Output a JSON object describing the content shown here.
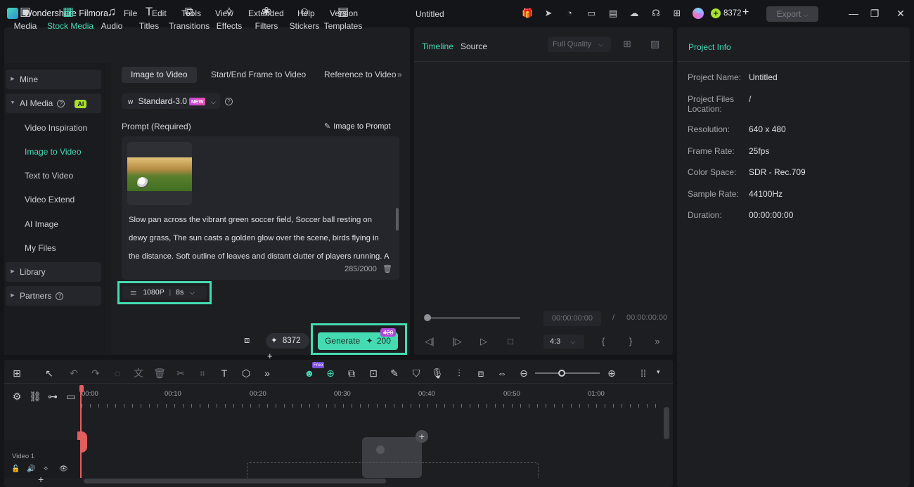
{
  "app": {
    "name": "Wondershare Filmora",
    "doc_title": "Untitled"
  },
  "menu": [
    "File",
    "Edit",
    "Tools",
    "View",
    "Extended",
    "Help",
    "Version"
  ],
  "credits": {
    "value": "8372"
  },
  "export_label": "Export",
  "toolbar": [
    "Media",
    "Stock Media",
    "Audio",
    "Titles",
    "Transitions",
    "Effects",
    "Filters",
    "Stickers",
    "Templates"
  ],
  "sidebar": {
    "mine": "Mine",
    "ai_media": "AI Media",
    "ai_badge": "AI",
    "subitems": [
      "Video Inspiration",
      "Image to Video",
      "Text to Video",
      "Video Extend",
      "AI Image",
      "My Files"
    ],
    "library": "Library",
    "partners": "Partners"
  },
  "content_tabs": [
    "Image to Video",
    "Start/End Frame to Video",
    "Reference to Video"
  ],
  "model": {
    "name": "Standard-3.0",
    "badge": "NEW"
  },
  "prompt": {
    "label": "Prompt (Required)",
    "image_to_prompt": "Image to Prompt",
    "text": "Slow pan across the vibrant green soccer field, Soccer ball resting on dewy grass, The sun casts a golden glow over the scene, birds flying in the distance. Soft outline of leaves and distant clutter of players running. A",
    "counter": "285/2000"
  },
  "settings_chip": {
    "resolution": "1080P",
    "duration": "8s"
  },
  "generate": {
    "label": "Generate",
    "cost": "200",
    "old_cost": "420",
    "credits": "8372"
  },
  "viewer": {
    "tab_timeline": "Timeline",
    "tab_source": "Source",
    "quality": "Full Quality",
    "time_current": "00:00:00:00",
    "time_sep": "/",
    "time_total": "00:00:00:00",
    "ratio": "4:3"
  },
  "project_info": {
    "title": "Project Info",
    "rows": [
      {
        "k": "Project Name:",
        "v": "Untitled"
      },
      {
        "k": "Project Files Location:",
        "v": "/"
      },
      {
        "k": "Resolution:",
        "v": "640 x 480"
      },
      {
        "k": "Frame Rate:",
        "v": "25fps"
      },
      {
        "k": "Color Space:",
        "v": "SDR - Rec.709"
      },
      {
        "k": "Sample Rate:",
        "v": "44100Hz"
      },
      {
        "k": "Duration:",
        "v": "00:00:00:00"
      }
    ]
  },
  "timeline": {
    "ruler": [
      "00:00",
      "00:10",
      "00:20",
      "00:30",
      "00:40",
      "00:50",
      "01:00"
    ],
    "track_name": "Video 1",
    "free_badge": "Free"
  }
}
